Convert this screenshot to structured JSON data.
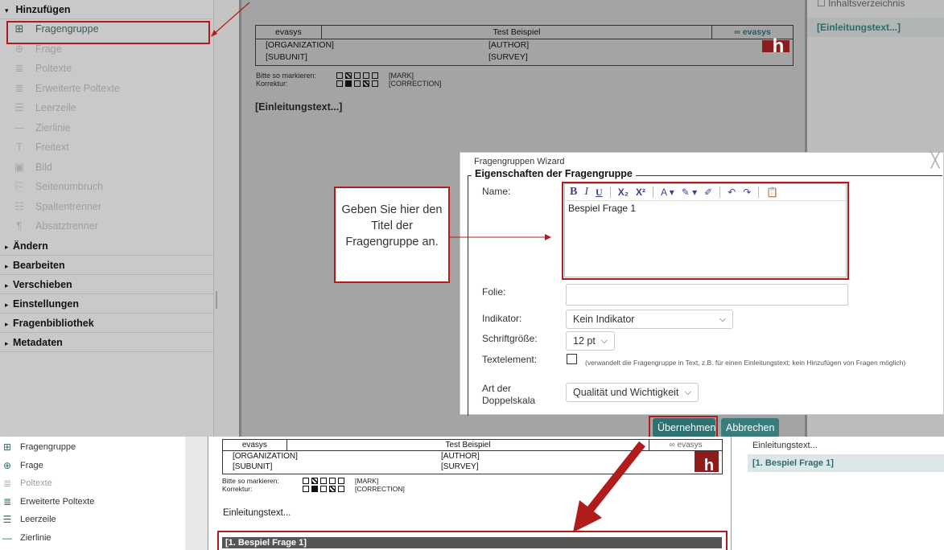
{
  "sidebar": {
    "sections": [
      {
        "label": "Hinzufügen",
        "arrow": "▾"
      },
      {
        "label": "Ändern",
        "arrow": "▸"
      },
      {
        "label": "Bearbeiten",
        "arrow": "▸"
      },
      {
        "label": "Verschieben",
        "arrow": "▸"
      },
      {
        "label": "Einstellungen",
        "arrow": "▸"
      },
      {
        "label": "Fragenbibliothek",
        "arrow": "▸"
      },
      {
        "label": "Metadaten",
        "arrow": "▸"
      }
    ],
    "tools": [
      {
        "label": "Fragengruppe",
        "icon": "folder-plus-icon",
        "glyph": "⊞"
      },
      {
        "label": "Frage",
        "icon": "speech-plus-icon",
        "glyph": "⊕"
      },
      {
        "label": "Poltexte",
        "icon": "lines-icon",
        "glyph": "≣"
      },
      {
        "label": "Erweiterte Poltexte",
        "icon": "lines-icon",
        "glyph": "≣"
      },
      {
        "label": "Leerzeile",
        "icon": "blank-line-icon",
        "glyph": "☰"
      },
      {
        "label": "Zierlinie",
        "icon": "rule-line-icon",
        "glyph": "—"
      },
      {
        "label": "Freitext",
        "icon": "text-t-icon",
        "glyph": "T"
      },
      {
        "label": "Bild",
        "icon": "image-icon",
        "glyph": "▣"
      },
      {
        "label": "Seitenumbruch",
        "icon": "page-break-icon",
        "glyph": "⎘"
      },
      {
        "label": "Spaltentrenner",
        "icon": "column-icon",
        "glyph": "☷"
      },
      {
        "label": "Absatztrenner",
        "icon": "pilcrow-icon",
        "glyph": "¶"
      }
    ]
  },
  "document": {
    "brand": "evasys",
    "survey_title": "Test Beispiel",
    "logo_brand": "evasys",
    "organization": "[ORGANIZATION]",
    "author": "[AUTHOR]",
    "subunit": "[SUBUNIT]",
    "survey": "[SURVEY]",
    "mark_label": "Bitte so markieren:",
    "mark_tag": "[MARK]",
    "correction_label": "Korrektur:",
    "correction_tag": "[CORRECTION]",
    "intro_text": "[Einleitungstext...]",
    "logo_letter": "h"
  },
  "right_panel": {
    "items_top": [
      "Inhaltsverzeichnis",
      "[Einleitungstext...]"
    ],
    "items_bottom": [
      "Einleitungstext...",
      "[1. Bespiel Frage 1]"
    ]
  },
  "wizard": {
    "title": "Fragengruppen Wizard",
    "legend": "Eigenschaften der Fragengruppe",
    "name_label": "Name:",
    "name_value": "Bespiel Frage 1",
    "toolbar": [
      "B",
      "I",
      "U",
      "X₂",
      "X²",
      "A ▾",
      "✎ ▾",
      "✐",
      "↶",
      "↷",
      "📋"
    ],
    "folie_label": "Folie:",
    "indikator_label": "Indikator:",
    "indikator_value": "Kein Indikator",
    "schrift_label": "Schriftgröße:",
    "schrift_value": "12 pt",
    "textelement_label": "Textelement:",
    "textelement_note": "(verwandelt die Fragengruppe in Text, z.B. für einen Einleitungstext; kein Hinzufügen von Fragen möglich)",
    "doppelskala_label_1": "Art der",
    "doppelskala_label_2": "Doppelskala",
    "doppelskala_value": "Qualität und Wichtigkeit",
    "apply_button": "Übernehmen",
    "cancel_button": "Abbrechen"
  },
  "callout": {
    "text": "Geben Sie hier den Titel der Fragengruppe an."
  },
  "bottom": {
    "tools": [
      {
        "label": "Fragengruppe",
        "glyph": "⊞",
        "dim": false
      },
      {
        "label": "Frage",
        "glyph": "⊕",
        "dim": false
      },
      {
        "label": "Poltexte",
        "glyph": "≣",
        "dim": true
      },
      {
        "label": "Erweiterte Poltexte",
        "glyph": "≣",
        "dim": false
      },
      {
        "label": "Leerzeile",
        "glyph": "☰",
        "dim": false
      },
      {
        "label": "Zierlinie",
        "glyph": "—",
        "dim": false
      }
    ],
    "intro_text": "Einleitungstext...",
    "new_group": "[1. Bespiel Frage 1]"
  },
  "colors": {
    "accent": "#2f7070",
    "highlight": "#b01c1c"
  }
}
